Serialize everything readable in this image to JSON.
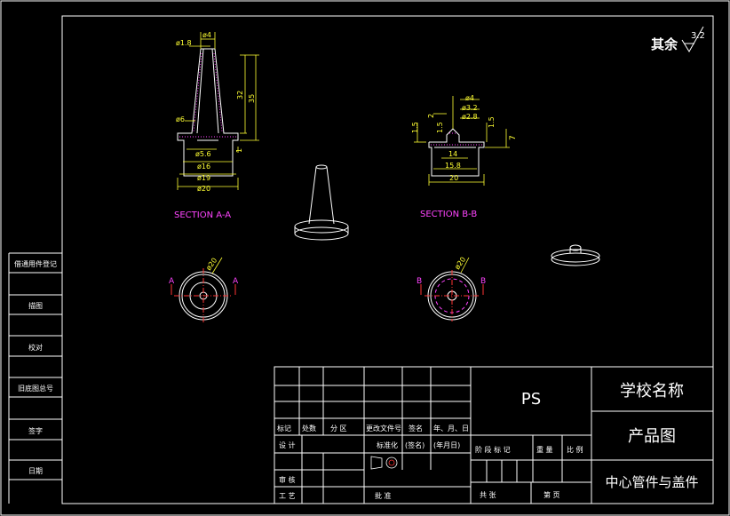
{
  "roughness": {
    "prefix": "其余",
    "value": "3.2"
  },
  "left_strip": {
    "labels": [
      "借通用件登记",
      "旧底图总号",
      "描图",
      "校对",
      "旧底图总号",
      "签字",
      "日期"
    ]
  },
  "section_a": {
    "title": "SECTION A-A",
    "dims": [
      "ø4",
      "ø1.8",
      "ø6",
      "32",
      "35",
      "1",
      "ø5.6",
      "ø16",
      "ø19",
      "ø20"
    ],
    "cut_label_left": "A",
    "cut_label_right": "A",
    "plan_dim": "ø20"
  },
  "section_b": {
    "title": "SECTION B-B",
    "dims": [
      "ø4",
      "ø3.2",
      "ø2.8",
      "2",
      "1.5",
      "1.5",
      "1.5",
      "7",
      "14",
      "15.8",
      "20"
    ],
    "cut_label_left": "B",
    "cut_label_right": "B",
    "plan_dim": "ø20"
  },
  "title_block": {
    "material": "PS",
    "school": "学校名称",
    "drawing_type": "产品图",
    "part_name": "中心管件与盖件",
    "header_labels": [
      "标记",
      "处数",
      "分 区",
      "更改文件号",
      "签名",
      "年、月、日"
    ],
    "row_labels_left": [
      "设 计",
      "审 核",
      "工 艺"
    ],
    "std_label": "标准化",
    "sig_label": "(签名)",
    "date_label": "(年月日)",
    "approve_label": "批 准",
    "stage_labels": [
      "阶 段 标 记",
      "重 量",
      "比 例"
    ],
    "sheet_labels": [
      "共 张",
      "第 页"
    ]
  },
  "colors": {
    "part": "#ffffff",
    "dimension": "#ffff33",
    "section_label": "#ff44ff",
    "center_line": "#ff3333",
    "border": "#ffffff"
  }
}
